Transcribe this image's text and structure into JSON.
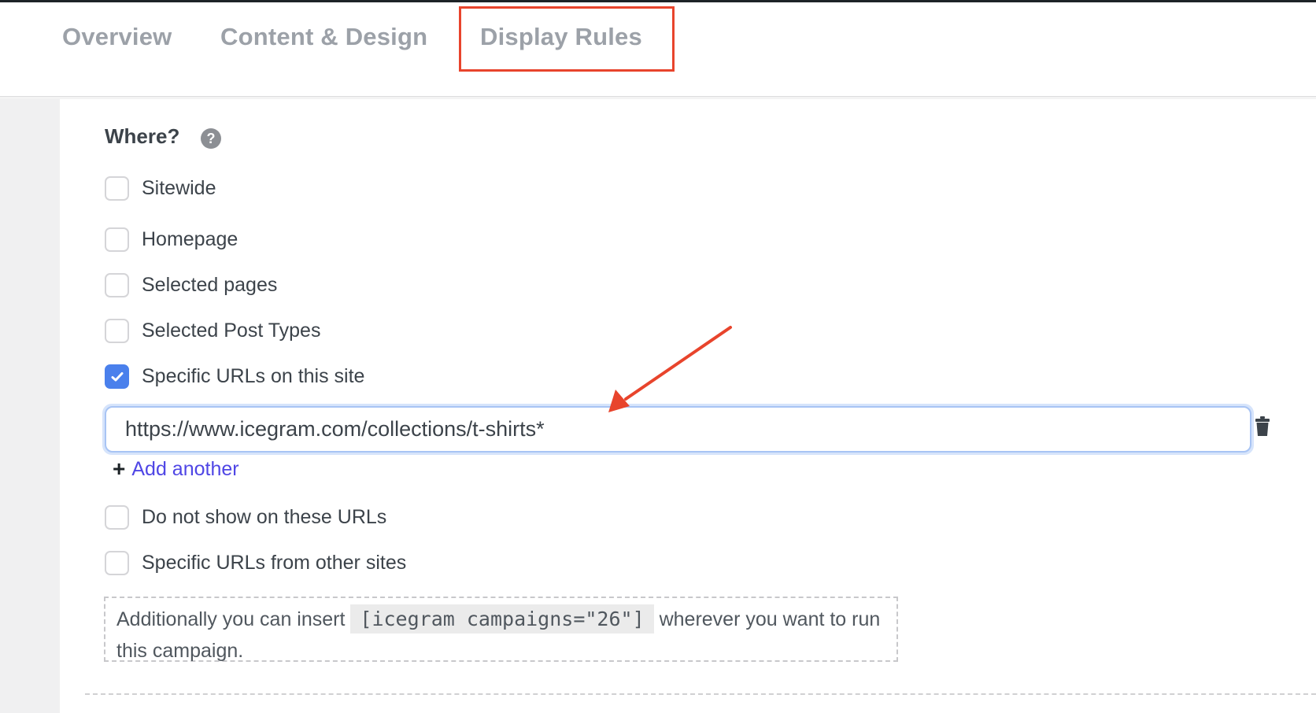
{
  "tabs": [
    {
      "label": "Overview",
      "active": false
    },
    {
      "label": "Content & Design",
      "active": false
    },
    {
      "label": "Display Rules",
      "active": true
    }
  ],
  "annotation": {
    "highlight_color": "#e8442c",
    "arrow_color": "#e8442c",
    "highlighted_tab": "Display Rules"
  },
  "where": {
    "title": "Where?",
    "help_icon": "question-circle-icon",
    "options": [
      {
        "label": "Sitewide",
        "checked": false
      },
      {
        "label": "Homepage",
        "checked": false
      },
      {
        "label": "Selected pages",
        "checked": false
      },
      {
        "label": "Selected Post Types",
        "checked": false
      },
      {
        "label": "Specific URLs on this site",
        "checked": true
      },
      {
        "label": "Do not show on these URLs",
        "checked": false
      },
      {
        "label": "Specific URLs from other sites",
        "checked": false
      }
    ],
    "url_input": {
      "value": "https://www.icegram.com/collections/t-shirts*"
    },
    "delete_icon": "trash-icon",
    "add_another": {
      "icon": "plus-icon",
      "label": "Add another"
    },
    "shortcode_note": {
      "prefix": "Additionally you can insert",
      "code": "[icegram campaigns=\"26\"]",
      "suffix": "wherever you want to run this campaign."
    }
  },
  "colors": {
    "accent": "#4a80ec",
    "link": "#4f46e5",
    "tab_text": "#9ca1a8",
    "text": "#3c434a"
  }
}
